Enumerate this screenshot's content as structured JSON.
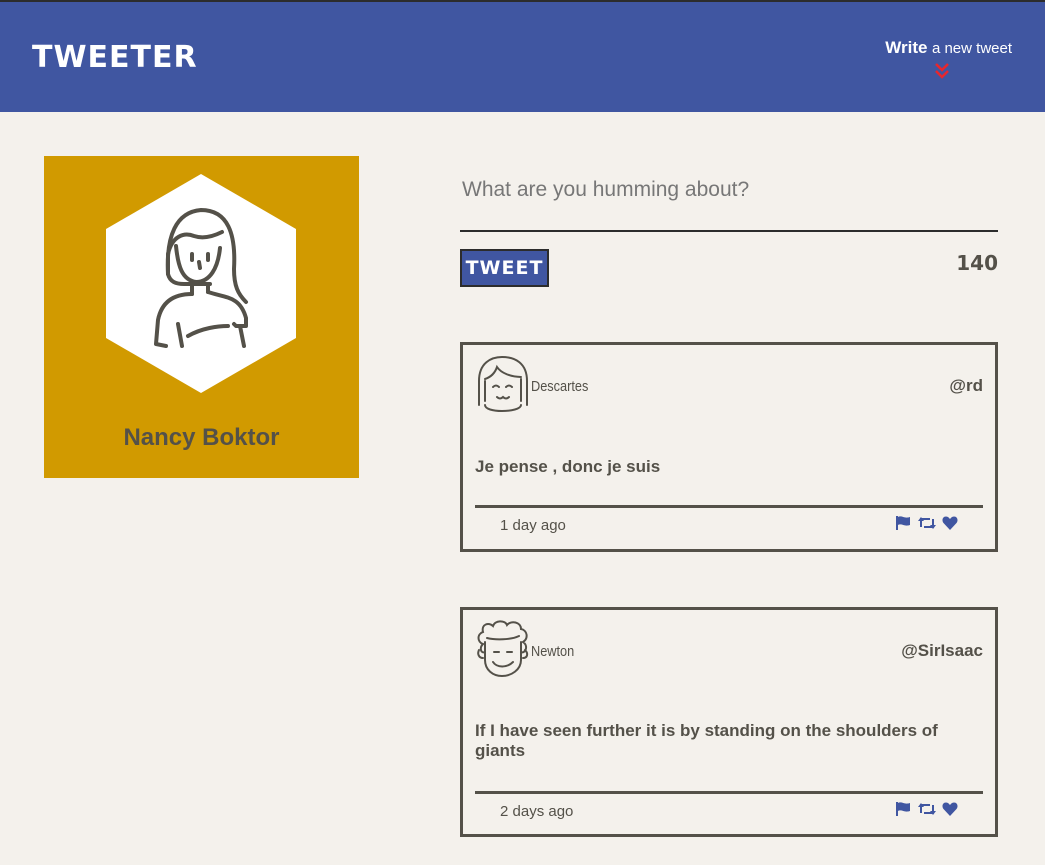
{
  "nav": {
    "brand": "TWEETER",
    "compose_strong": "Write",
    "compose_rest": "a new tweet",
    "chevron_color": "#e8262d"
  },
  "colors": {
    "nav_bg": "#4056a1",
    "page_bg": "#f4f1ec",
    "profile_bg": "#d19a00",
    "text": "#545149",
    "icon_blue": "#4056a1"
  },
  "profile": {
    "name": "Nancy Boktor",
    "avatar_icon": "woman-avatar-icon"
  },
  "composer": {
    "placeholder": "What are you humming about?",
    "value": "",
    "tweet_button": "TWEET",
    "counter": "140"
  },
  "tweets": [
    {
      "name": "Descartes",
      "handle": "@rd",
      "content": "Je pense , donc je suis",
      "time": "1 day ago",
      "avatar_icon": "bob-haircut-avatar-icon"
    },
    {
      "name": "Newton",
      "handle": "@SirIsaac",
      "content": "If I have seen further it is by standing on the shoulders of giants",
      "time": "2 days ago",
      "avatar_icon": "curly-hair-avatar-icon"
    }
  ],
  "action_icons": [
    "flag-icon",
    "retweet-icon",
    "heart-icon"
  ]
}
